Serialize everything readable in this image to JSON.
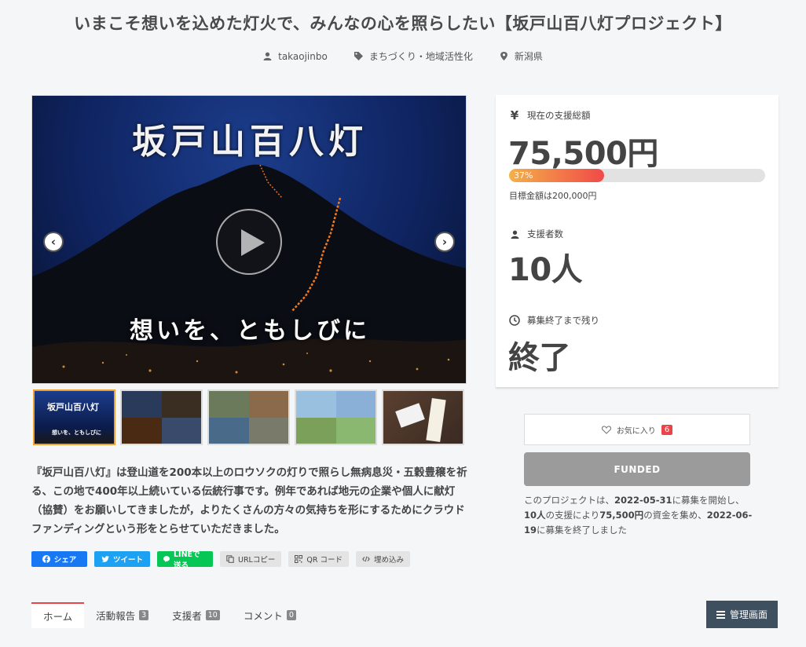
{
  "project": {
    "title": "いまこそ想いを込めた灯火で、みんなの心を照らしたい【坂戸山百八灯プロジェクト】",
    "owner": "takaojinbo",
    "category": "まちづくり・地域活性化",
    "location": "新潟県"
  },
  "video": {
    "title_text": "坂戸山百八灯",
    "subtitle_text": "想いを、ともしびに",
    "prev_symbol": "‹",
    "next_symbol": "›"
  },
  "thumbnails": [
    {
      "title": "坂戸山百八灯",
      "subtitle": "想いを、ともしびに"
    },
    {},
    {},
    {},
    {}
  ],
  "description": "『坂戸山百八灯』は登山道を200本以上のロウソクの灯りで照らし無病息災・五穀豊穣を祈る、この地で400年以上続いている伝統行事です。例年であれば地元の企業や個人に献灯（協賛）をお願いしてきましたが，よりたくさんの方々の気持ちを形にするためにクラウドファンディングという形をとらせていただきました。",
  "share": {
    "facebook": "シェア",
    "twitter": "ツイート",
    "line": "LINEで送る",
    "url_copy": "URLコピー",
    "qr": "QR コード",
    "embed": "埋め込み"
  },
  "stats": {
    "amount_label": "現在の支援総額",
    "amount_value": "75,500円",
    "progress_text": "37%",
    "progress_fraction": 0.37,
    "target_text": "目標金額は200,000円",
    "supporters_label": "支援者数",
    "supporters_value": "10人",
    "remaining_label": "募集終了まで残り",
    "remaining_value": "終了"
  },
  "actions": {
    "favorite_label": "お気に入り",
    "favorite_count": "6",
    "funded_label": "FUNDED"
  },
  "summary": {
    "part1": "このプロジェクトは、",
    "start_date": "2022-05-31",
    "part2": "に募集を開始し、",
    "supporters": "10人",
    "part3": "の支援により",
    "amount": "75,500円",
    "part4": "の資金を集め、",
    "end_date": "2022-06-19",
    "part5": "に募集を終了しました"
  },
  "tabs": [
    {
      "label": "ホーム",
      "count": ""
    },
    {
      "label": "活動報告",
      "count": "3"
    },
    {
      "label": "支援者",
      "count": "10"
    },
    {
      "label": "コメント",
      "count": "0"
    }
  ],
  "admin_label": "管理画面",
  "colors": {
    "accent": "#e8454a",
    "progress_start": "#f4b048",
    "progress_end": "#f04a48",
    "funded": "#9b9b9b",
    "admin": "#3e4f5f"
  }
}
